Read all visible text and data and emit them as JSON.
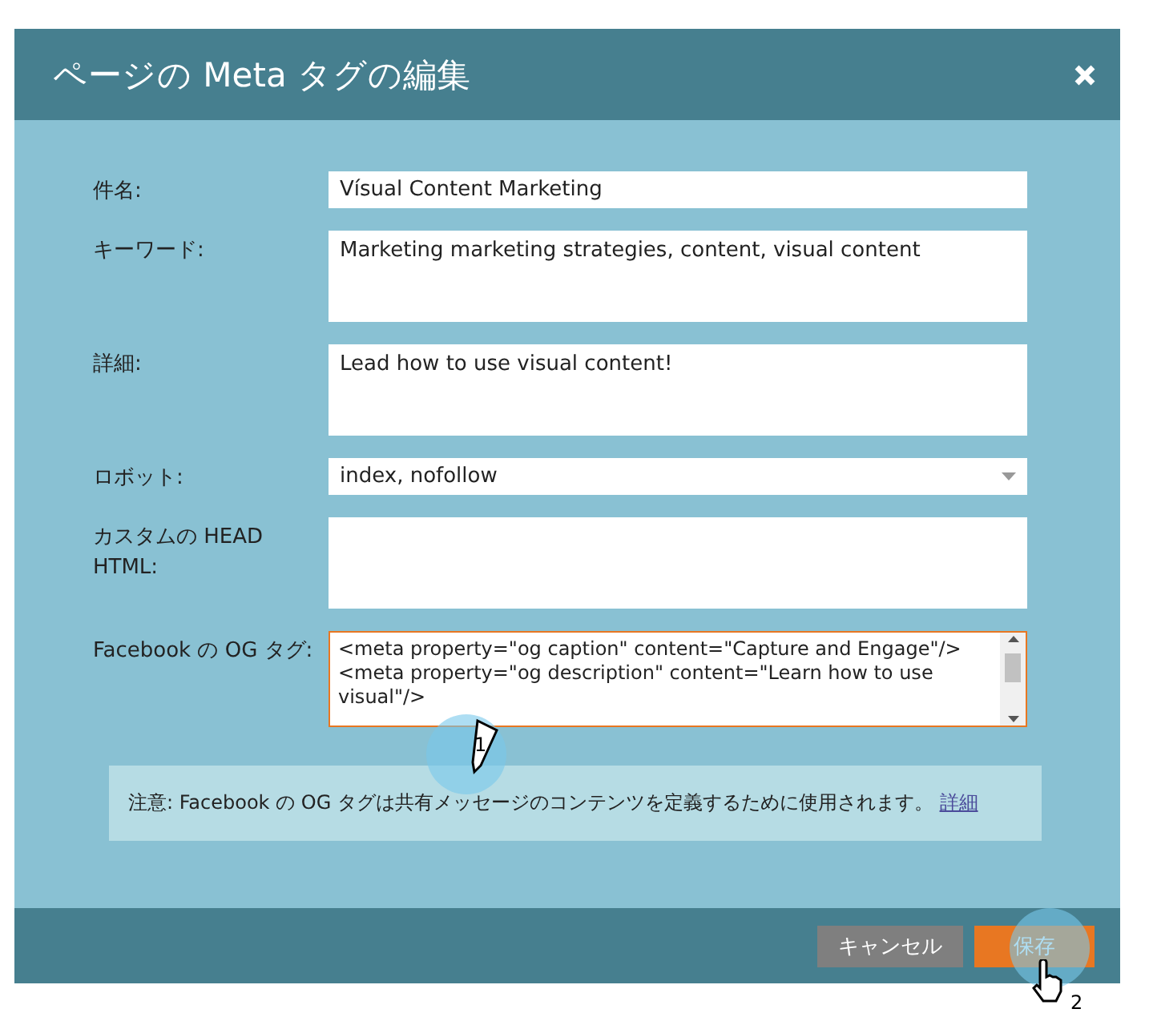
{
  "dialog": {
    "title": "ページの Meta タグの編集",
    "fields": [
      {
        "kind": "text",
        "label": "件名:",
        "value": "Vísual Content Marketing"
      },
      {
        "kind": "textarea",
        "label": "キーワード:",
        "value": "Marketing marketing strategies, content, visual content"
      },
      {
        "kind": "textarea",
        "label": "詳細:",
        "value": "Lead how to use visual content!"
      },
      {
        "kind": "select",
        "label": "ロボット:",
        "value": "index, nofollow"
      },
      {
        "kind": "textarea",
        "label": "カスタムの HEAD HTML:"
      },
      {
        "kind": "code",
        "label": "Facebook の OG タグ:",
        "focused": true,
        "lines": [
          "<meta property=\"og caption\" content=\"Capture and Engage\"/>",
          "<meta property=\"og description\" content=\"Learn how to use visual\"/>"
        ]
      }
    ],
    "note": {
      "text": "注意: Facebook の OG タグは共有メッセージのコンテンツを定義するために使用されます。",
      "link": "詳細"
    },
    "buttons": [
      {
        "kind": "secondary",
        "label": "キャンセル"
      },
      {
        "kind": "primary",
        "label": "保存"
      }
    ]
  },
  "callouts": [
    {
      "kind": "pencil",
      "number": "1"
    },
    {
      "kind": "hand",
      "number": "2"
    }
  ]
}
